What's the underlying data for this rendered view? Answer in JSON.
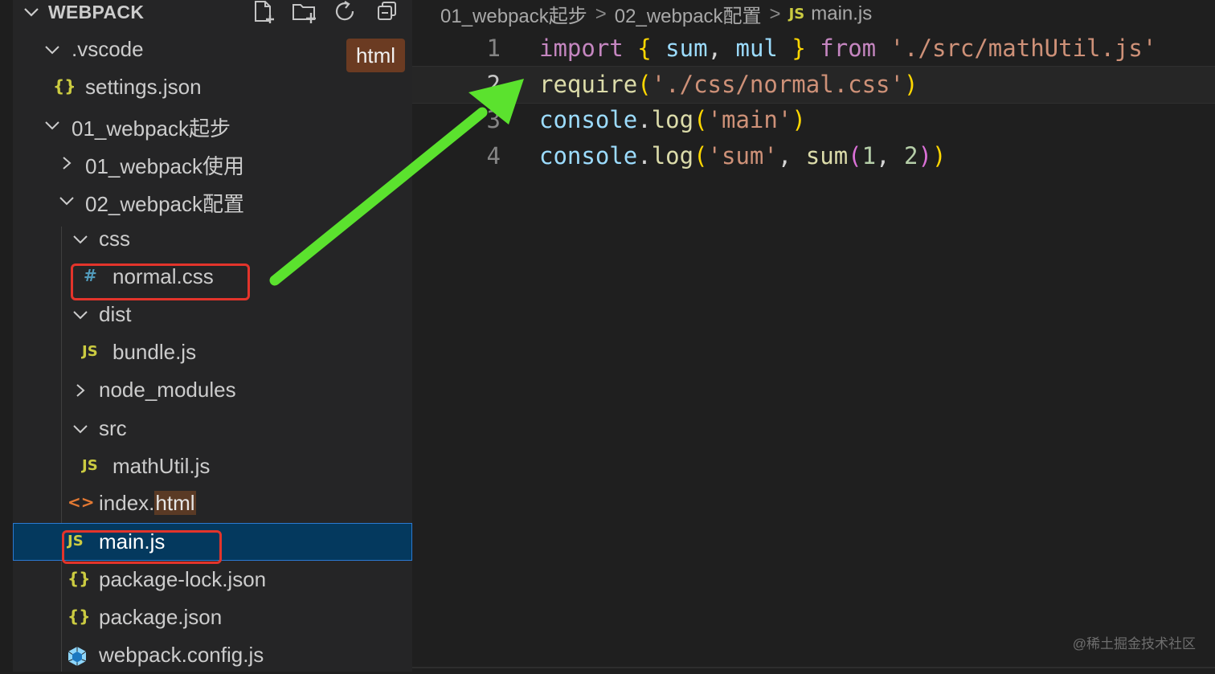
{
  "explorer": {
    "title": "WEBPACK",
    "actions": [
      "new-file-icon",
      "new-folder-icon",
      "refresh-icon",
      "collapse-all-icon"
    ],
    "tooltip": "html",
    "tree": [
      {
        "label": ".vscode",
        "kind": "folder",
        "expanded": true
      },
      {
        "label": "settings.json",
        "kind": "json-file",
        "icon": "{}"
      },
      {
        "label": "01_webpack起步",
        "kind": "folder",
        "expanded": true
      },
      {
        "label": "01_webpack使用",
        "kind": "folder",
        "expanded": false
      },
      {
        "label": "02_webpack配置",
        "kind": "folder",
        "expanded": true
      },
      {
        "label": "css",
        "kind": "folder",
        "expanded": true
      },
      {
        "label": "normal.css",
        "kind": "css-file",
        "icon": "#",
        "highlighted_box": true
      },
      {
        "label": "dist",
        "kind": "folder",
        "expanded": true
      },
      {
        "label": "bundle.js",
        "kind": "js-file",
        "icon": "JS"
      },
      {
        "label": "node_modules",
        "kind": "folder",
        "expanded": false
      },
      {
        "label": "src",
        "kind": "folder",
        "expanded": true
      },
      {
        "label": "mathUtil.js",
        "kind": "js-file",
        "icon": "JS"
      },
      {
        "label_parts": [
          "index.",
          "html"
        ],
        "kind": "html-file",
        "icon": "<>"
      },
      {
        "label": "main.js",
        "kind": "js-file",
        "icon": "JS",
        "selected": true,
        "highlighted_box": true
      },
      {
        "label": "package-lock.json",
        "kind": "json-file",
        "icon": "{}"
      },
      {
        "label": "package.json",
        "kind": "json-file",
        "icon": "{}"
      },
      {
        "label": "webpack.config.js",
        "kind": "webpack-file"
      }
    ]
  },
  "editor": {
    "breadcrumb": [
      "01_webpack起步",
      "02_webpack配置",
      "main.js"
    ],
    "breadcrumb_file_icon": "JS",
    "lines": [
      {
        "n": "1",
        "tokens": [
          [
            "import",
            "kw"
          ],
          [
            " ",
            "pl"
          ],
          [
            "{",
            "br"
          ],
          [
            " ",
            "pl"
          ],
          [
            "sum",
            "var"
          ],
          [
            ", ",
            "pl"
          ],
          [
            "mul",
            "var"
          ],
          [
            " ",
            "pl"
          ],
          [
            "}",
            "br"
          ],
          [
            " ",
            "pl"
          ],
          [
            "from",
            "kw"
          ],
          [
            " ",
            "pl"
          ],
          [
            "'./src/mathUtil.js'",
            "str"
          ]
        ]
      },
      {
        "n": "2",
        "active": true,
        "tokens": [
          [
            "require",
            "fn"
          ],
          [
            "(",
            "br"
          ],
          [
            "'./css/normal.css'",
            "str"
          ],
          [
            ")",
            "br"
          ]
        ]
      },
      {
        "n": "3",
        "tokens": [
          [
            "console",
            "var"
          ],
          [
            ".",
            "pl"
          ],
          [
            "log",
            "fn"
          ],
          [
            "(",
            "br"
          ],
          [
            "'main'",
            "str"
          ],
          [
            ")",
            "br"
          ]
        ]
      },
      {
        "n": "4",
        "tokens": [
          [
            "console",
            "var"
          ],
          [
            ".",
            "pl"
          ],
          [
            "log",
            "fn"
          ],
          [
            "(",
            "br"
          ],
          [
            "'sum'",
            "str"
          ],
          [
            ", ",
            "pl"
          ],
          [
            "sum",
            "fn"
          ],
          [
            "(",
            "pu"
          ],
          [
            "1",
            "num"
          ],
          [
            ", ",
            "pl"
          ],
          [
            "2",
            "num"
          ],
          [
            ")",
            "pu"
          ],
          [
            ")",
            "br"
          ]
        ]
      }
    ]
  },
  "watermark": "@稀土掘金技术社区",
  "colors": {
    "annotation_arrow": "#5be22e",
    "annotation_box": "#e3342b",
    "selection": "#04395e"
  }
}
